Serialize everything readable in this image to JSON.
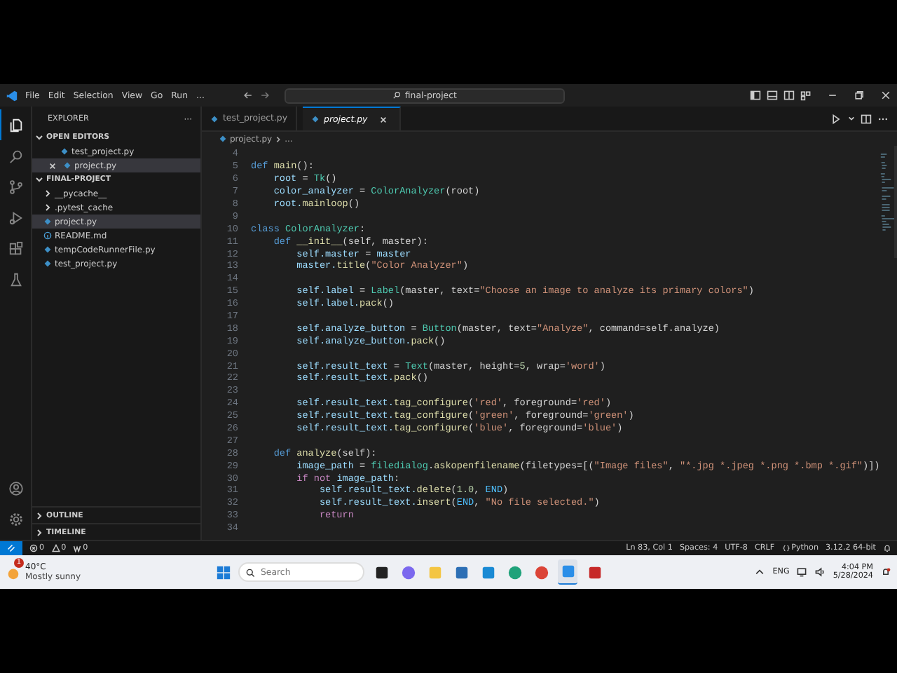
{
  "title_bar": {
    "menu": [
      "File",
      "Edit",
      "Selection",
      "View",
      "Go",
      "Run",
      "..."
    ],
    "search": "final-project"
  },
  "activity_bar": [
    {
      "kind": "files",
      "selected": true
    },
    {
      "kind": "search",
      "selected": false
    },
    {
      "kind": "source-control",
      "selected": false
    },
    {
      "kind": "run",
      "selected": false
    },
    {
      "kind": "extensions",
      "selected": false
    },
    {
      "kind": "testing",
      "selected": false
    }
  ],
  "activity_bottom": [
    {
      "kind": "account"
    },
    {
      "kind": "settings"
    }
  ],
  "sidebar": {
    "title": "EXPLORER",
    "more": "···",
    "sections": [
      {
        "title": "OPEN EDITORS",
        "expanded": true,
        "items": [
          {
            "name": "test_project.py",
            "kind": "python",
            "selected": false,
            "closable": false
          },
          {
            "name": "project.py",
            "kind": "python",
            "selected": true,
            "closable": true
          }
        ]
      },
      {
        "title": "FINAL-PROJECT",
        "expanded": true,
        "items": [
          {
            "name": "__pycache__",
            "kind": "folder",
            "selected": false,
            "closable": false
          },
          {
            "name": ".pytest_cache",
            "kind": "folder",
            "selected": false,
            "closable": false
          },
          {
            "name": "project.py",
            "kind": "python",
            "selected": true,
            "closable": false
          },
          {
            "name": "README.md",
            "kind": "info",
            "selected": false,
            "closable": false
          },
          {
            "name": "tempCodeRunnerFile.py",
            "kind": "python",
            "selected": false,
            "closable": false
          },
          {
            "name": "test_project.py",
            "kind": "python",
            "selected": false,
            "closable": false
          }
        ]
      }
    ],
    "panels": [
      {
        "title": "OUTLINE",
        "expanded": false
      },
      {
        "title": "TIMELINE",
        "expanded": false
      }
    ]
  },
  "tabs": [
    {
      "name": "test_project.py",
      "selected": false
    },
    {
      "name": "project.py",
      "selected": true
    }
  ],
  "breadcrumb": [
    "project.py",
    "..."
  ],
  "lines": [
    {
      "number": "4"
    },
    {
      "number": "5",
      "tokens": [
        {
          "text": "def ",
          "kind": "keyword"
        },
        {
          "text": "main",
          "kind": "function"
        },
        {
          "text": "():",
          "kind": "plain"
        }
      ]
    },
    {
      "number": "6",
      "tokens": [
        {
          "text": "    root",
          "kind": "variable"
        },
        {
          "text": " = ",
          "kind": "plain"
        },
        {
          "text": "Tk",
          "kind": "class"
        },
        {
          "text": "()",
          "kind": "plain"
        }
      ]
    },
    {
      "number": "7",
      "tokens": [
        {
          "text": "    color_analyzer",
          "kind": "variable"
        },
        {
          "text": " = ",
          "kind": "plain"
        },
        {
          "text": "ColorAnalyzer",
          "kind": "class"
        },
        {
          "text": "(root)",
          "kind": "plain"
        }
      ]
    },
    {
      "number": "8",
      "tokens": [
        {
          "text": "    root.",
          "kind": "variable"
        },
        {
          "text": "mainloop",
          "kind": "function"
        },
        {
          "text": "()",
          "kind": "plain"
        }
      ]
    },
    {
      "number": "9"
    },
    {
      "number": "10",
      "tokens": [
        {
          "text": "class ",
          "kind": "keyword"
        },
        {
          "text": "ColorAnalyzer",
          "kind": "class"
        },
        {
          "text": ":",
          "kind": "plain"
        }
      ]
    },
    {
      "number": "11",
      "tokens": [
        {
          "text": "    def ",
          "kind": "keyword"
        },
        {
          "text": "__init__",
          "kind": "function"
        },
        {
          "text": "(self, master):",
          "kind": "plain"
        }
      ]
    },
    {
      "number": "12",
      "tokens": [
        {
          "text": "        self.master",
          "kind": "variable"
        },
        {
          "text": " = ",
          "kind": "plain"
        },
        {
          "text": "master",
          "kind": "variable"
        }
      ]
    },
    {
      "number": "13",
      "tokens": [
        {
          "text": "        master.",
          "kind": "variable"
        },
        {
          "text": "title",
          "kind": "function"
        },
        {
          "text": "(",
          "kind": "plain"
        },
        {
          "text": "\"Color Analyzer\"",
          "kind": "string"
        },
        {
          "text": ")",
          "kind": "plain"
        }
      ]
    },
    {
      "number": "14"
    },
    {
      "number": "15",
      "tokens": [
        {
          "text": "        self.label",
          "kind": "variable"
        },
        {
          "text": " = ",
          "kind": "plain"
        },
        {
          "text": "Label",
          "kind": "class"
        },
        {
          "text": "(master, text=",
          "kind": "plain"
        },
        {
          "text": "\"Choose an image to analyze its primary colors\"",
          "kind": "string"
        },
        {
          "text": ")",
          "kind": "plain"
        }
      ]
    },
    {
      "number": "16",
      "tokens": [
        {
          "text": "        self.label.",
          "kind": "variable"
        },
        {
          "text": "pack",
          "kind": "function"
        },
        {
          "text": "()",
          "kind": "plain"
        }
      ]
    },
    {
      "number": "17"
    },
    {
      "number": "18",
      "tokens": [
        {
          "text": "        self.analyze_button",
          "kind": "variable"
        },
        {
          "text": " = ",
          "kind": "plain"
        },
        {
          "text": "Button",
          "kind": "class"
        },
        {
          "text": "(master, text=",
          "kind": "plain"
        },
        {
          "text": "\"Analyze\"",
          "kind": "string"
        },
        {
          "text": ", command=self.analyze)",
          "kind": "plain"
        }
      ]
    },
    {
      "number": "19",
      "tokens": [
        {
          "text": "        self.analyze_button.",
          "kind": "variable"
        },
        {
          "text": "pack",
          "kind": "function"
        },
        {
          "text": "()",
          "kind": "plain"
        }
      ]
    },
    {
      "number": "20"
    },
    {
      "number": "21",
      "tokens": [
        {
          "text": "        self.result_text",
          "kind": "variable"
        },
        {
          "text": " = ",
          "kind": "plain"
        },
        {
          "text": "Text",
          "kind": "class"
        },
        {
          "text": "(master, height=",
          "kind": "plain"
        },
        {
          "text": "5",
          "kind": "number"
        },
        {
          "text": ", wrap=",
          "kind": "plain"
        },
        {
          "text": "'word'",
          "kind": "string"
        },
        {
          "text": ")",
          "kind": "plain"
        }
      ]
    },
    {
      "number": "22",
      "tokens": [
        {
          "text": "        self.result_text.",
          "kind": "variable"
        },
        {
          "text": "pack",
          "kind": "function"
        },
        {
          "text": "()",
          "kind": "plain"
        }
      ]
    },
    {
      "number": "23"
    },
    {
      "number": "24",
      "tokens": [
        {
          "text": "        self.result_text.",
          "kind": "variable"
        },
        {
          "text": "tag_configure",
          "kind": "function"
        },
        {
          "text": "(",
          "kind": "plain"
        },
        {
          "text": "'red'",
          "kind": "string"
        },
        {
          "text": ", foreground=",
          "kind": "plain"
        },
        {
          "text": "'red'",
          "kind": "string"
        },
        {
          "text": ")",
          "kind": "plain"
        }
      ]
    },
    {
      "number": "25",
      "tokens": [
        {
          "text": "        self.result_text.",
          "kind": "variable"
        },
        {
          "text": "tag_configure",
          "kind": "function"
        },
        {
          "text": "(",
          "kind": "plain"
        },
        {
          "text": "'green'",
          "kind": "string"
        },
        {
          "text": ", foreground=",
          "kind": "plain"
        },
        {
          "text": "'green'",
          "kind": "string"
        },
        {
          "text": ")",
          "kind": "plain"
        }
      ]
    },
    {
      "number": "26",
      "tokens": [
        {
          "text": "        self.result_text.",
          "kind": "variable"
        },
        {
          "text": "tag_configure",
          "kind": "function"
        },
        {
          "text": "(",
          "kind": "plain"
        },
        {
          "text": "'blue'",
          "kind": "string"
        },
        {
          "text": ", foreground=",
          "kind": "plain"
        },
        {
          "text": "'blue'",
          "kind": "string"
        },
        {
          "text": ")",
          "kind": "plain"
        }
      ]
    },
    {
      "number": "27"
    },
    {
      "number": "28",
      "tokens": [
        {
          "text": "    def ",
          "kind": "keyword"
        },
        {
          "text": "analyze",
          "kind": "function"
        },
        {
          "text": "(self):",
          "kind": "plain"
        }
      ]
    },
    {
      "number": "29",
      "tokens": [
        {
          "text": "        image_path",
          "kind": "variable"
        },
        {
          "text": " = ",
          "kind": "plain"
        },
        {
          "text": "filedialog",
          "kind": "class"
        },
        {
          "text": ".",
          "kind": "plain"
        },
        {
          "text": "askopenfilename",
          "kind": "function"
        },
        {
          "text": "(filetypes=[(",
          "kind": "plain"
        },
        {
          "text": "\"Image files\"",
          "kind": "string"
        },
        {
          "text": ", ",
          "kind": "plain"
        },
        {
          "text": "\"*.jpg *.jpeg *.png *.bmp *.gif\"",
          "kind": "string"
        },
        {
          "text": ")])",
          "kind": "plain"
        }
      ]
    },
    {
      "number": "30",
      "tokens": [
        {
          "text": "        if not ",
          "kind": "control"
        },
        {
          "text": "image_path",
          "kind": "variable"
        },
        {
          "text": ":",
          "kind": "plain"
        }
      ]
    },
    {
      "number": "31",
      "tokens": [
        {
          "text": "            self.result_text.",
          "kind": "variable"
        },
        {
          "text": "delete",
          "kind": "function"
        },
        {
          "text": "(",
          "kind": "plain"
        },
        {
          "text": "1.0",
          "kind": "number"
        },
        {
          "text": ", ",
          "kind": "plain"
        },
        {
          "text": "END",
          "kind": "constant"
        },
        {
          "text": ")",
          "kind": "plain"
        }
      ]
    },
    {
      "number": "32",
      "tokens": [
        {
          "text": "            self.result_text.",
          "kind": "variable"
        },
        {
          "text": "insert",
          "kind": "function"
        },
        {
          "text": "(",
          "kind": "plain"
        },
        {
          "text": "END",
          "kind": "constant"
        },
        {
          "text": ", ",
          "kind": "plain"
        },
        {
          "text": "\"No file selected.\"",
          "kind": "string"
        },
        {
          "text": ")",
          "kind": "plain"
        }
      ]
    },
    {
      "number": "33",
      "tokens": [
        {
          "text": "            return",
          "kind": "control"
        }
      ]
    },
    {
      "number": "34"
    }
  ],
  "status_bar": {
    "left": [
      {
        "kind": "errors",
        "text": "0"
      },
      {
        "kind": "warnings",
        "text": "0"
      },
      {
        "kind": "ports",
        "text": "0"
      }
    ],
    "right": [
      {
        "kind": "text",
        "text": "Ln 83, Col 1"
      },
      {
        "kind": "text",
        "text": "Spaces: 4"
      },
      {
        "kind": "text",
        "text": "UTF-8"
      },
      {
        "kind": "text",
        "text": "CRLF"
      },
      {
        "kind": "language",
        "text": "Python"
      },
      {
        "kind": "text",
        "text": "3.12.2 64-bit"
      }
    ]
  },
  "taskbar": {
    "weather": {
      "badge": "1",
      "temperature": "40°C",
      "condition": "Mostly sunny"
    },
    "search": {
      "placeholder": "Search"
    },
    "apps": [
      {
        "kind": "task-view",
        "selected": false
      },
      {
        "kind": "chat",
        "selected": false
      },
      {
        "kind": "folder",
        "selected": false
      },
      {
        "kind": "store",
        "selected": false
      },
      {
        "kind": "mail",
        "selected": false
      },
      {
        "kind": "edge",
        "selected": false
      },
      {
        "kind": "chrome",
        "selected": false
      },
      {
        "kind": "code",
        "selected": true
      },
      {
        "kind": "recorder",
        "selected": false
      }
    ],
    "language": "ENG",
    "time": "4:04 PM",
    "date": "5/28/2024"
  }
}
